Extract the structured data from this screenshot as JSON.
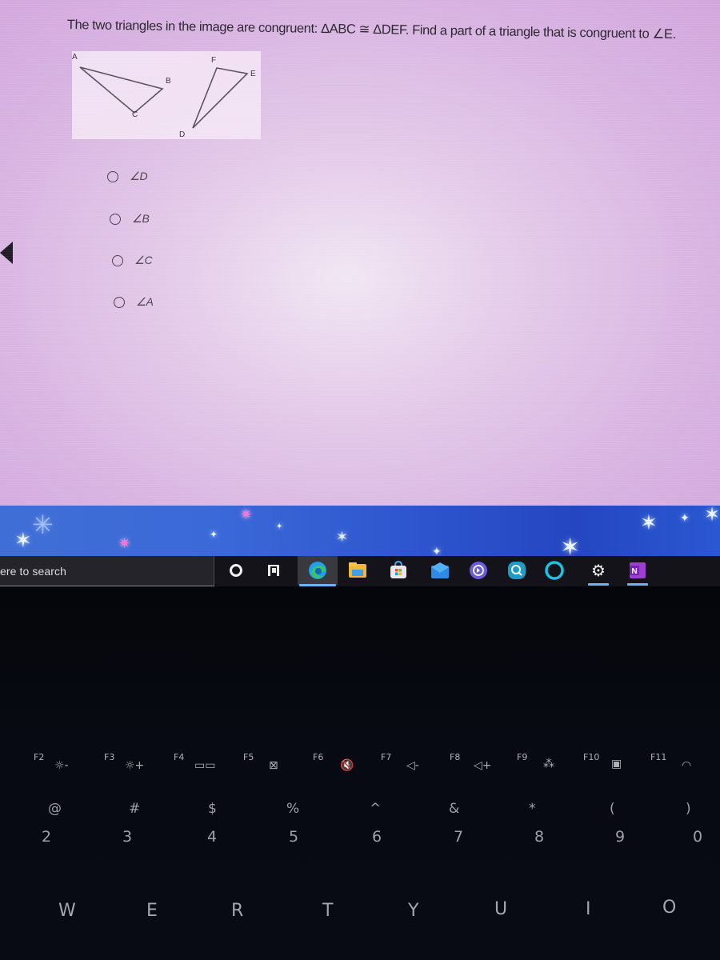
{
  "quiz": {
    "question": "The two triangles in the image are congruent: ΔABC ≅ ΔDEF. Find a part of a triangle that is congruent to ∠E.",
    "figure": {
      "triangle1": {
        "vertices": [
          "A",
          "B",
          "C"
        ]
      },
      "triangle2": {
        "vertices": [
          "D",
          "E",
          "F"
        ]
      },
      "labels": {
        "A": "A",
        "B": "B",
        "C": "C",
        "D": "D",
        "E": "E",
        "F": "F"
      }
    },
    "options": [
      {
        "label": "∠D",
        "selected": false
      },
      {
        "label": "∠B",
        "selected": false
      },
      {
        "label": "∠C",
        "selected": false
      },
      {
        "label": "∠A",
        "selected": false
      }
    ]
  },
  "taskbar": {
    "search_placeholder": "ere to search",
    "icons": [
      {
        "name": "cortana-icon",
        "active": false
      },
      {
        "name": "task-view-icon",
        "active": false
      },
      {
        "name": "edge-icon",
        "active": true
      },
      {
        "name": "file-explorer-icon",
        "active": false
      },
      {
        "name": "microsoft-store-icon",
        "active": false
      },
      {
        "name": "mail-icon",
        "active": false
      },
      {
        "name": "screen-share-icon",
        "active": false
      },
      {
        "name": "search-app-icon",
        "active": false
      },
      {
        "name": "alexa-icon",
        "active": false
      },
      {
        "name": "settings-icon",
        "active": true
      },
      {
        "name": "onenote-icon",
        "active": true
      }
    ],
    "onenote_letter": "N",
    "colors": {
      "active_indicator": "#6fb2f4",
      "edge": "#1fa0e8",
      "onenote": "#9b3fd0"
    }
  },
  "keyboard": {
    "function_keys": [
      {
        "label": "F2",
        "glyph": "☼-"
      },
      {
        "label": "F3",
        "glyph": "☼+"
      },
      {
        "label": "F4",
        "glyph": "▭▭"
      },
      {
        "label": "F5",
        "glyph": "⊠"
      },
      {
        "label": "F6",
        "glyph": "🔇"
      },
      {
        "label": "F7",
        "glyph": "◁-"
      },
      {
        "label": "F8",
        "glyph": "◁+"
      },
      {
        "label": "F9",
        "glyph": "⁂"
      },
      {
        "label": "F10",
        "glyph": "▣"
      },
      {
        "label": "F11",
        "glyph": "◠"
      }
    ],
    "number_keys": [
      {
        "shift": "@",
        "main": "2"
      },
      {
        "shift": "#",
        "main": "3"
      },
      {
        "shift": "$",
        "main": "4"
      },
      {
        "shift": "%",
        "main": "5"
      },
      {
        "shift": "^",
        "main": "6"
      },
      {
        "shift": "&",
        "main": "7"
      },
      {
        "shift": "*",
        "main": "8"
      },
      {
        "shift": "(",
        "main": "9"
      },
      {
        "shift": ")",
        "main": "0"
      }
    ],
    "letter_keys": [
      "W",
      "E",
      "R",
      "T",
      "Y",
      "U",
      "I",
      "O"
    ]
  }
}
